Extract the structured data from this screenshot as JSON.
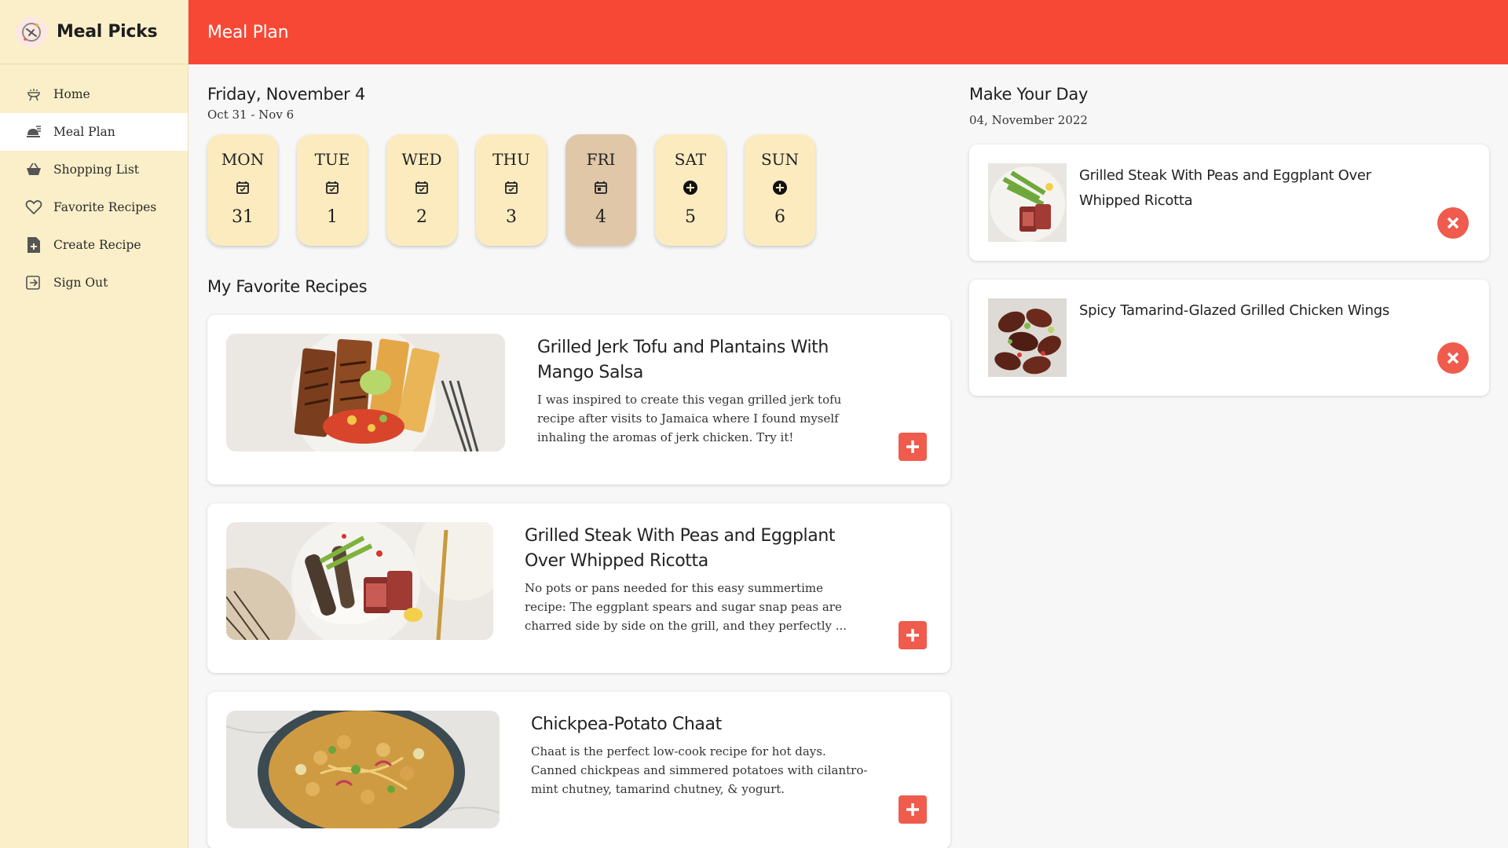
{
  "app": {
    "name": "Meal Picks"
  },
  "header": {
    "title": "Meal Plan"
  },
  "sidebar": {
    "items": [
      {
        "label": "Home",
        "icon": "grill-icon"
      },
      {
        "label": "Meal Plan",
        "icon": "serving-icon",
        "active": true
      },
      {
        "label": "Shopping List",
        "icon": "basket-icon"
      },
      {
        "label": "Favorite Recipes",
        "icon": "heart-icon"
      },
      {
        "label": "Create Recipe",
        "icon": "file-plus-icon"
      },
      {
        "label": "Sign Out",
        "icon": "sign-out-icon"
      }
    ]
  },
  "week": {
    "heading": "Friday, November 4",
    "range": "Oct 31 - Nov 6",
    "days": [
      {
        "name": "MON",
        "num": "31",
        "icon": "calendar-check-icon"
      },
      {
        "name": "TUE",
        "num": "1",
        "icon": "calendar-check-icon"
      },
      {
        "name": "WED",
        "num": "2",
        "icon": "calendar-check-icon"
      },
      {
        "name": "THU",
        "num": "3",
        "icon": "calendar-check-icon"
      },
      {
        "name": "FRI",
        "num": "4",
        "icon": "calendar-today-icon",
        "selected": true
      },
      {
        "name": "SAT",
        "num": "5",
        "icon": "add-circle-icon"
      },
      {
        "name": "SUN",
        "num": "6",
        "icon": "add-circle-icon"
      }
    ]
  },
  "favorites": {
    "title": "My Favorite Recipes",
    "recipes": [
      {
        "title": "Grilled Jerk Tofu and Plantains With Mango Salsa",
        "description": "I was inspired to create this vegan grilled jerk tofu recipe after visits to Jamaica where I found myself inhaling the aromas of jerk chicken. Try it!"
      },
      {
        "title": "Grilled Steak With Peas and Eggplant Over Whipped Ricotta",
        "description": "No pots or pans needed for this easy summertime recipe: The eggplant spears and sugar snap peas are charred side by side on the grill, and they perfectly ..."
      },
      {
        "title": "Chickpea-Potato Chaat",
        "description": "Chaat is the perfect low-cook recipe for hot days. Canned chickpeas and simmered potatoes with cilantro-mint chutney, tamarind chutney, & yogurt."
      }
    ]
  },
  "day_plan": {
    "title": "Make Your Day",
    "date": "04, November 2022",
    "items": [
      {
        "title": "Grilled Steak With Peas and Eggplant Over Whipped Ricotta"
      },
      {
        "title": "Spicy Tamarind-Glazed Grilled Chicken Wings"
      }
    ]
  },
  "colors": {
    "header": "#f74835",
    "sidebar": "#fbefc9",
    "day_card": "#fbebbf",
    "day_selected": "#dfc7a8",
    "accent_button": "#ef5b4c"
  }
}
